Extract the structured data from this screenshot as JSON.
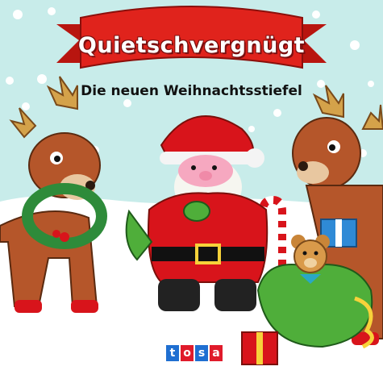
{
  "book": {
    "title": "Quietschvergnügt",
    "subtitle": "Die neuen Weihnachtsstiefel",
    "publisher_letters": [
      "t",
      "o",
      "s",
      "a"
    ]
  },
  "colors": {
    "sky": "#c8ecea",
    "ribbon": "#e0231c",
    "santa_red": "#d8141b",
    "reindeer": "#b5562a",
    "sack_green": "#4fae3a",
    "logo_blocks": [
      "#1f6fd1",
      "#e01b2b",
      "#1f6fd1",
      "#e01b2b"
    ]
  },
  "illustration": {
    "characters": [
      "santa-squeeze-toy",
      "reindeer-left",
      "reindeer-right",
      "teddy-bear",
      "gift-sack"
    ]
  }
}
